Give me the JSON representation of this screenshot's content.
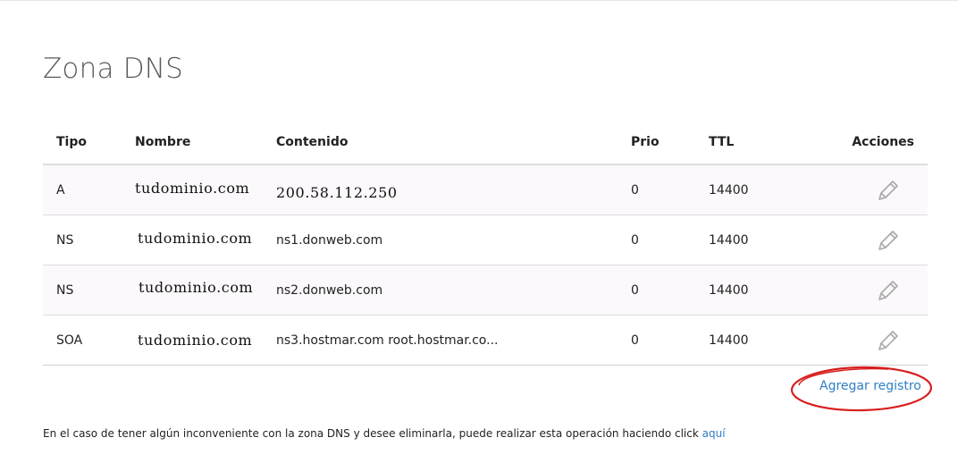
{
  "page": {
    "title": "Zona DNS"
  },
  "table": {
    "headers": {
      "tipo": "Tipo",
      "nombre": "Nombre",
      "contenido": "Contenido",
      "prio": "Prio",
      "ttl": "TTL",
      "acciones": "Acciones"
    },
    "rows": [
      {
        "tipo": "A",
        "nombre": "tudominio.com",
        "contenido": "200.58.112.250",
        "prio": "0",
        "ttl": "14400"
      },
      {
        "tipo": "NS",
        "nombre": "tudominio.com",
        "contenido": "ns1.donweb.com",
        "prio": "0",
        "ttl": "14400"
      },
      {
        "tipo": "NS",
        "nombre": "tudominio.com",
        "contenido": "ns2.donweb.com",
        "prio": "0",
        "ttl": "14400"
      },
      {
        "tipo": "SOA",
        "nombre": "tudominio.com",
        "contenido": "ns3.hostmar.com root.hostmar.co...",
        "prio": "0",
        "ttl": "14400"
      }
    ],
    "edit_icon": "pencil-icon"
  },
  "actions": {
    "add_record_label": "Agregar registro",
    "highlight_color": "#d81e1e"
  },
  "footer": {
    "note": "En el caso de tener algún inconveniente con la zona DNS y desee eliminarla, puede realizar esta operación haciendo click ",
    "link_label": "aquí"
  },
  "colors": {
    "link": "#2f7fc4",
    "title": "#5a5a5a",
    "row_stripe": "#fcf9fc",
    "border": "#dddddd"
  }
}
